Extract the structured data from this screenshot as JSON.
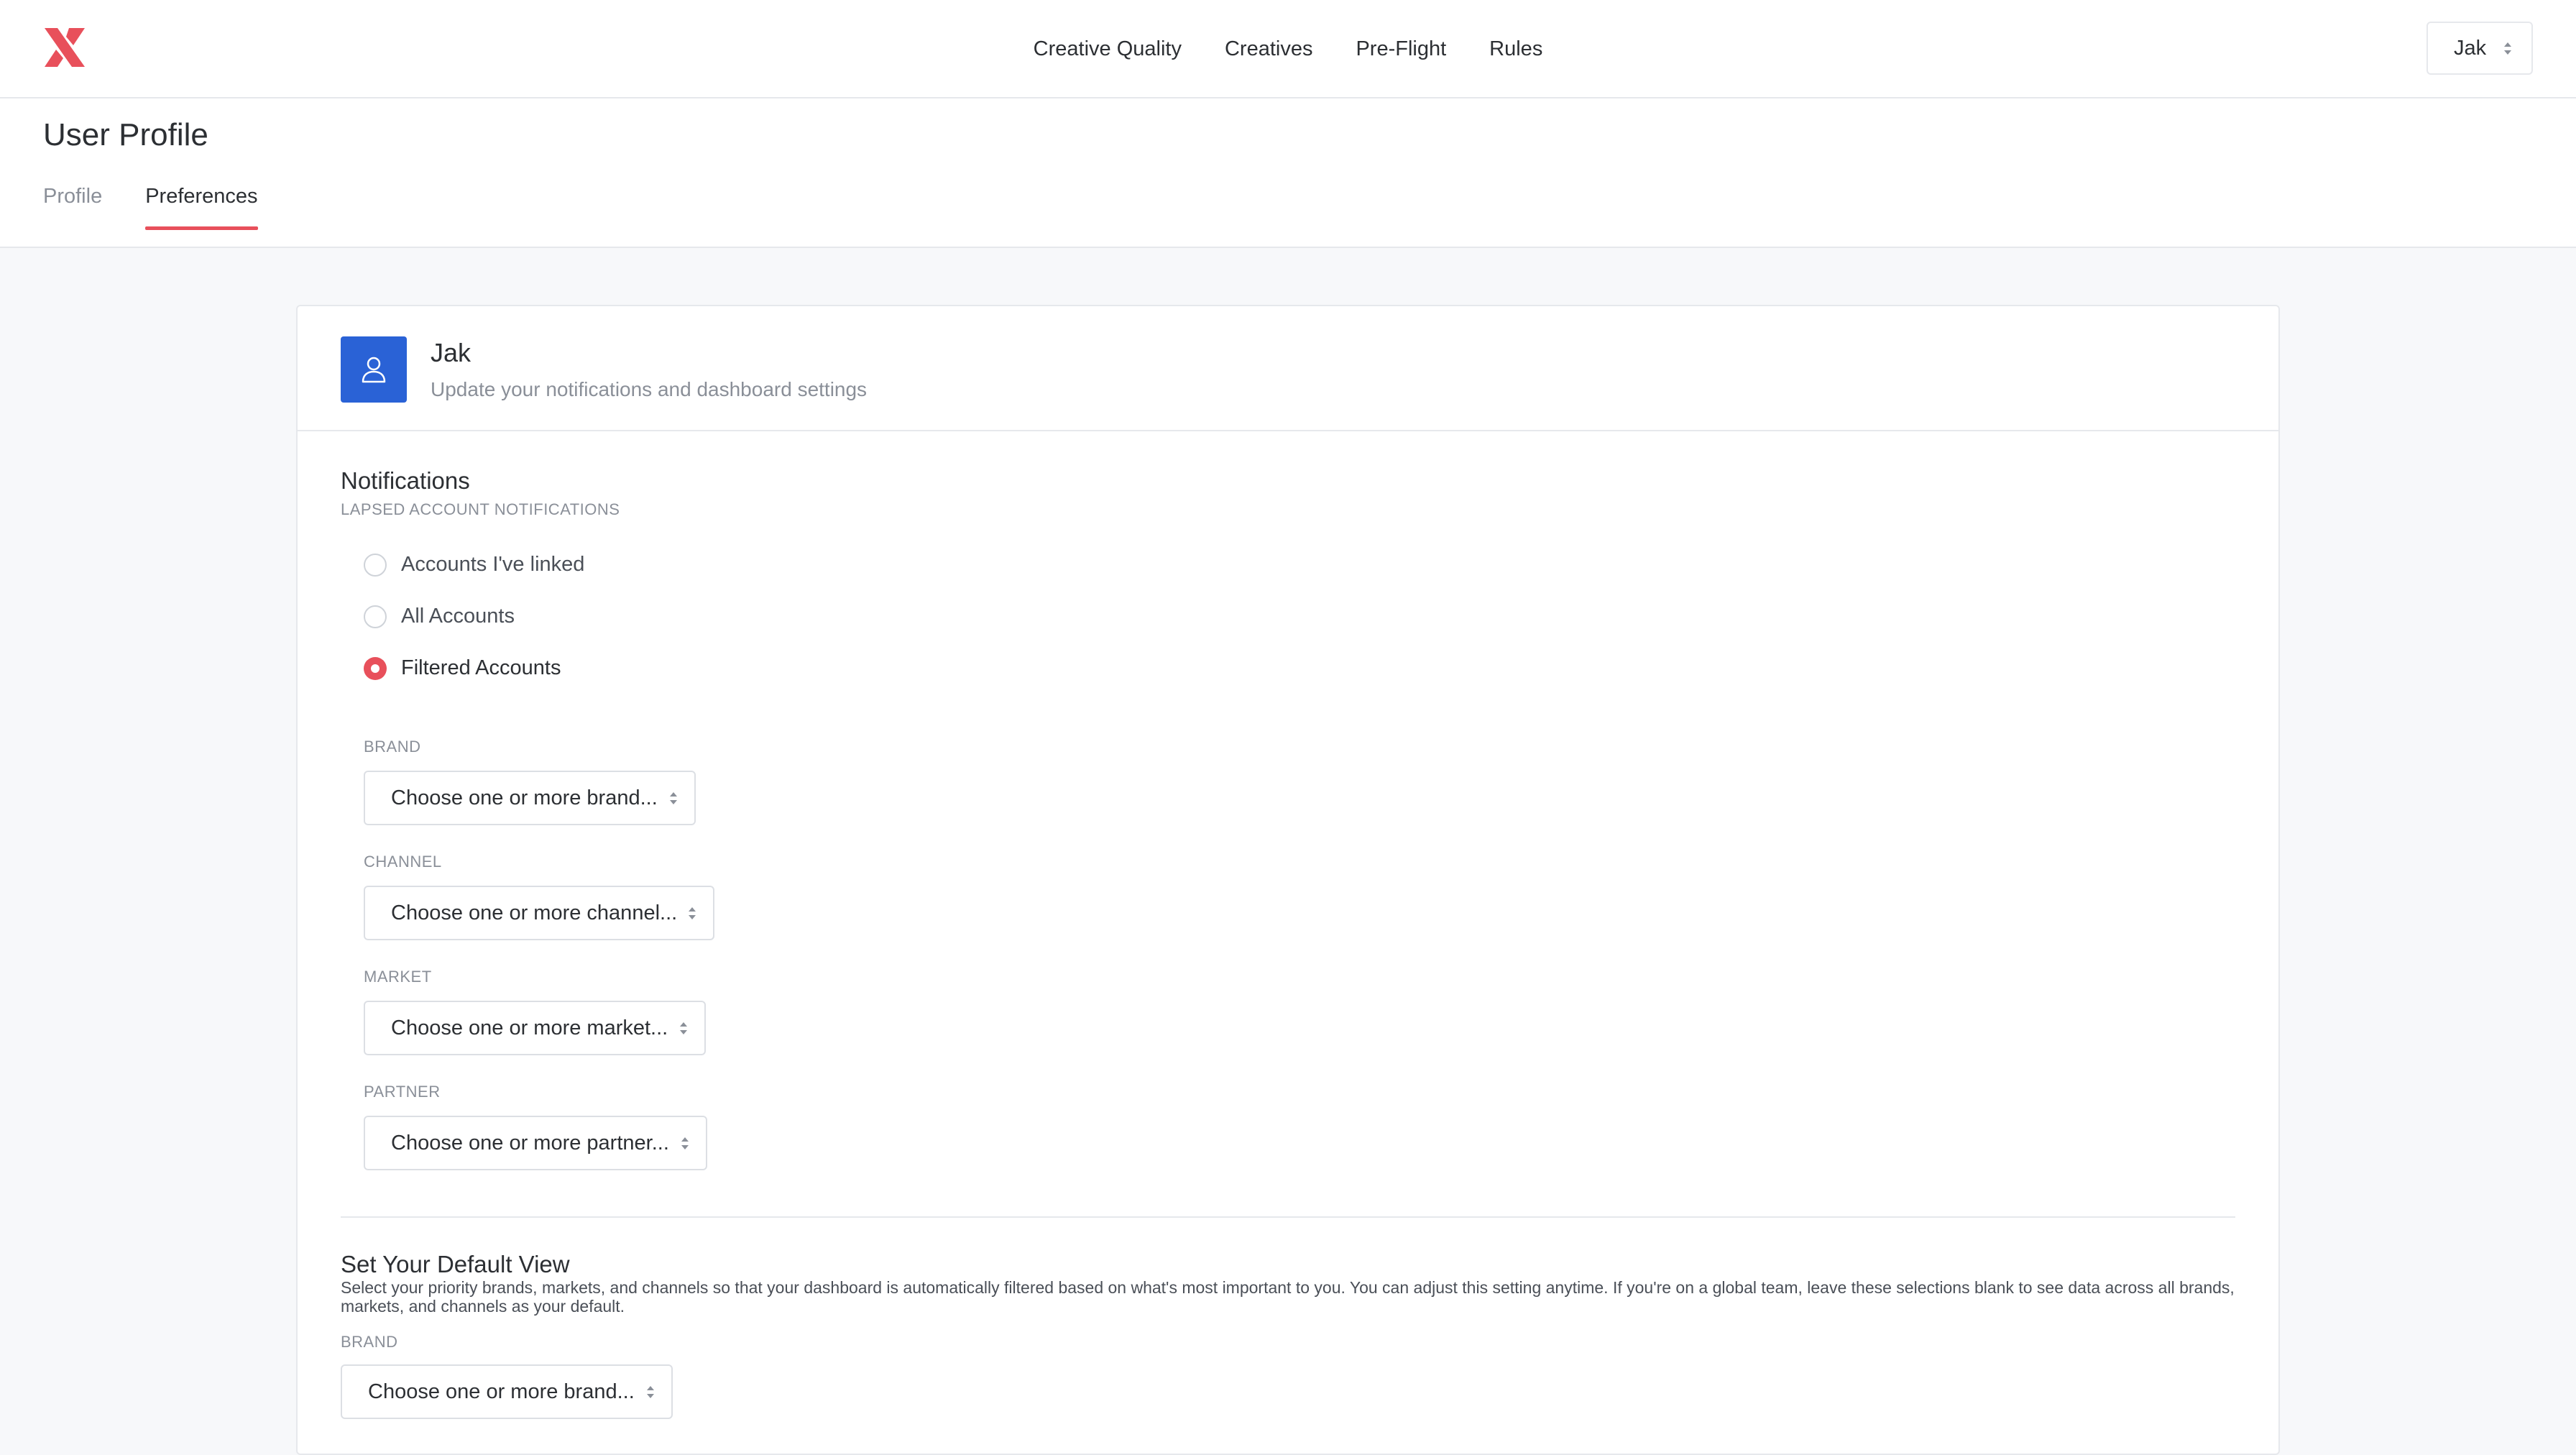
{
  "colors": {
    "accent": "#e8505b",
    "avatar": "#2a62d6"
  },
  "nav": {
    "logo_icon": "brand-logo-icon",
    "items": [
      "Creative Quality",
      "Creatives",
      "Pre-Flight",
      "Rules"
    ],
    "user_select": {
      "value": "Jak",
      "icon": "chevron-updown-icon"
    }
  },
  "page": {
    "title": "User Profile",
    "tabs": [
      {
        "label": "Profile",
        "active": false
      },
      {
        "label": "Preferences",
        "active": true
      }
    ]
  },
  "card": {
    "avatar_icon": "user-icon",
    "name": "Jak",
    "subtitle": "Update your notifications and dashboard settings",
    "notifications": {
      "title": "Notifications",
      "subtitle": "LAPSED ACCOUNT NOTIFICATIONS",
      "options": [
        {
          "label": "Accounts I've linked",
          "checked": false
        },
        {
          "label": "All Accounts",
          "checked": false
        },
        {
          "label": "Filtered Accounts",
          "checked": true
        }
      ],
      "filters": [
        {
          "label": "BRAND",
          "placeholder": "Choose one or more brand..."
        },
        {
          "label": "CHANNEL",
          "placeholder": "Choose one or more channel..."
        },
        {
          "label": "MARKET",
          "placeholder": "Choose one or more market..."
        },
        {
          "label": "PARTNER",
          "placeholder": "Choose one or more partner..."
        }
      ]
    },
    "default_view": {
      "title": "Set Your Default View",
      "description": "Select your priority brands, markets, and channels so that your dashboard is automatically filtered based on what's most important to you. You can adjust this setting anytime. If you're on a global team, leave these selections blank to see data across all brands, markets, and channels as your default.",
      "brand_label": "BRAND",
      "brand_placeholder": "Choose one or more brand..."
    }
  }
}
